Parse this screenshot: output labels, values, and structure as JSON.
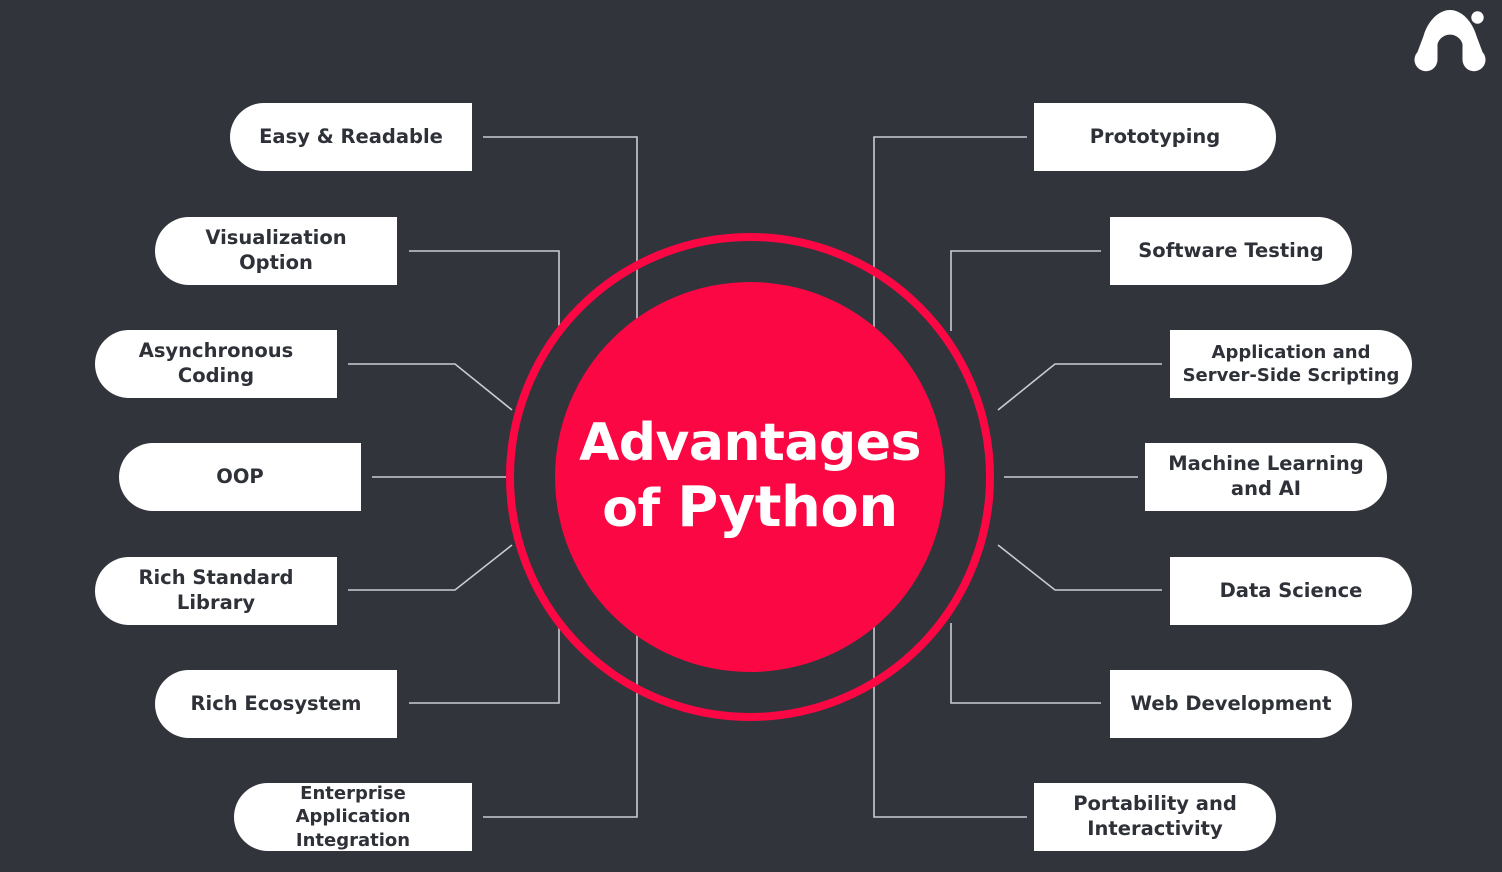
{
  "background_color": "#31343b",
  "accent_color": "#fa0744",
  "pill_background": "#ffffff",
  "pill_text_color": "#2e3138",
  "connector_color": "#c9ccd2",
  "center": {
    "line1": "Advantages",
    "line2_prefix": "of ",
    "line2_emphasis": "Python",
    "text_color": "#ffffff"
  },
  "logo": {
    "name": "arch-logo",
    "color": "#ffffff"
  },
  "left_items": [
    {
      "label": "Easy & Readable"
    },
    {
      "label": "Visualization Option"
    },
    {
      "label": "Asynchronous\nCoding"
    },
    {
      "label": "OOP"
    },
    {
      "label": "Rich Standard\nLibrary"
    },
    {
      "label": "Rich Ecosystem"
    },
    {
      "label": "Enterprise\nApplication Integration"
    }
  ],
  "right_items": [
    {
      "label": "Prototyping"
    },
    {
      "label": "Software Testing"
    },
    {
      "label": "Application and\nServer-Side Scripting"
    },
    {
      "label": "Machine Learning\nand AI"
    },
    {
      "label": "Data Science"
    },
    {
      "label": "Web Development"
    },
    {
      "label": "Portability and\nInteractivity"
    }
  ]
}
